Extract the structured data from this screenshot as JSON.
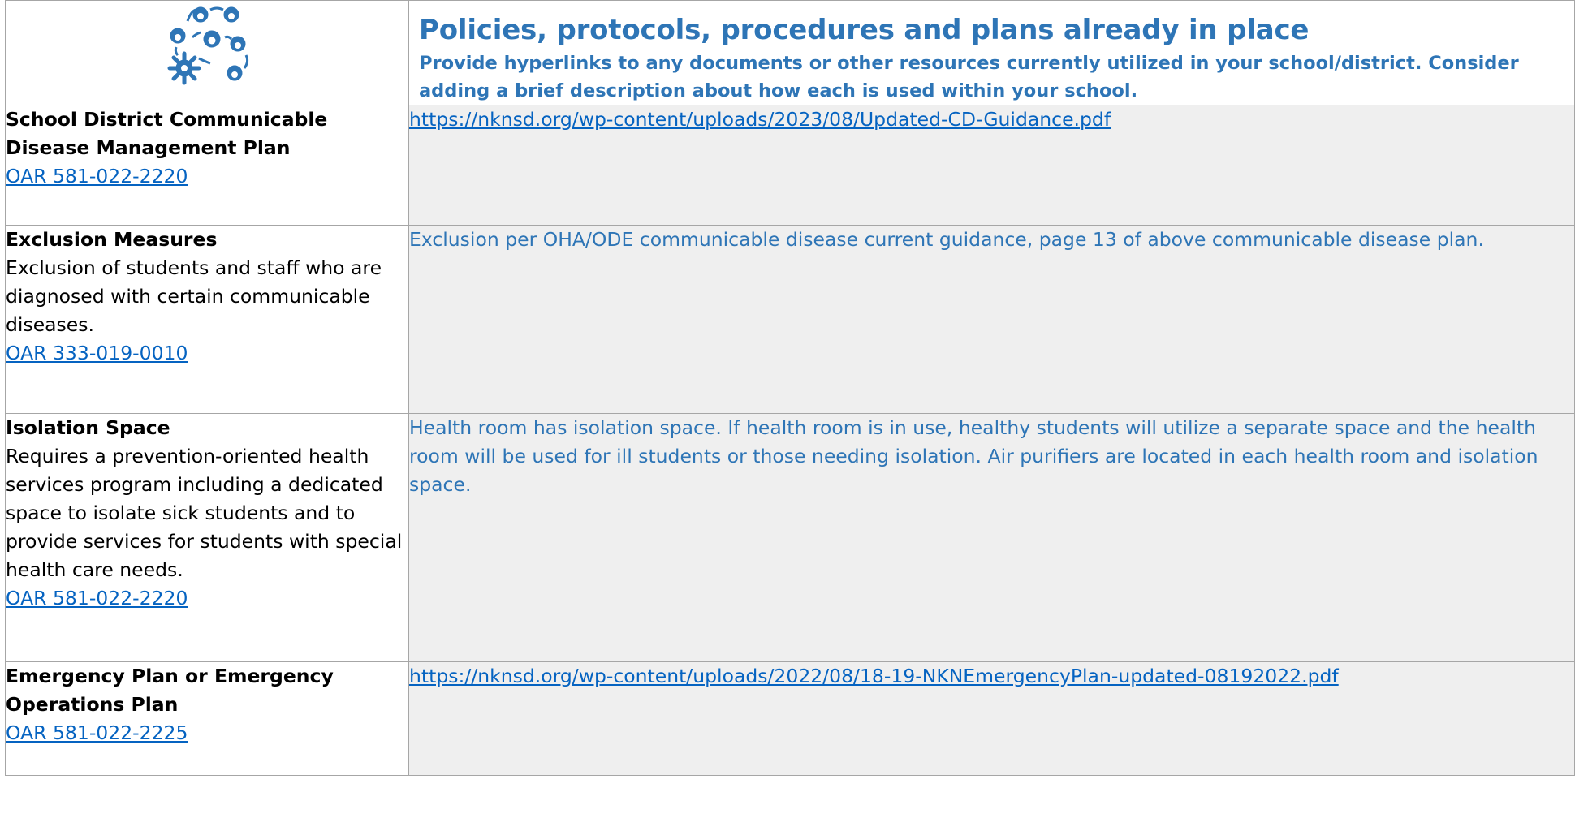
{
  "header": {
    "title": "Policies, protocols, procedures and plans already in place",
    "subtitle": "Provide hyperlinks to any documents or other resources currently utilized in your school/district. Consider adding a brief description about how each is used within your school.",
    "icon": "people-network-virus-icon",
    "accent_color": "#2e75b6"
  },
  "rows": [
    {
      "label": "School District Communicable Disease Management Plan",
      "description": "",
      "oar": "OAR 581-022-2220",
      "response": "https://nknsd.org/wp-content/uploads/2023/08/Updated-CD-Guidance.pdf",
      "response_is_link": true
    },
    {
      "label": "Exclusion Measures",
      "description": "Exclusion of students and staff who are diagnosed with certain communicable diseases.",
      "oar": "OAR 333-019-0010",
      "response": "Exclusion per OHA/ODE communicable disease current guidance, page 13 of above communicable disease plan.",
      "response_is_link": false
    },
    {
      "label": "Isolation Space",
      "description": "Requires a prevention-oriented health services program including a dedicated space to isolate sick students and to provide services for students with special health care needs.",
      "oar": "OAR 581-022-2220",
      "response": "Health room has isolation space. If health room is in use, healthy students will utilize a separate space and the health room will be used for ill students or those needing isolation. Air purifiers are located in each health room and isolation space.",
      "response_is_link": false
    },
    {
      "label": "Emergency Plan or Emergency Operations Plan",
      "description": "",
      "oar": "OAR 581-022-2225",
      "response": "https://nknsd.org/wp-content/uploads/2022/08/18-19-NKNEmergencyPlan-updated-08192022.pdf",
      "response_is_link": true
    }
  ],
  "colors": {
    "link": "#0563c1",
    "response_text": "#2e75b6",
    "cell_fill": "#efefef",
    "border": "#a6a6a6"
  }
}
